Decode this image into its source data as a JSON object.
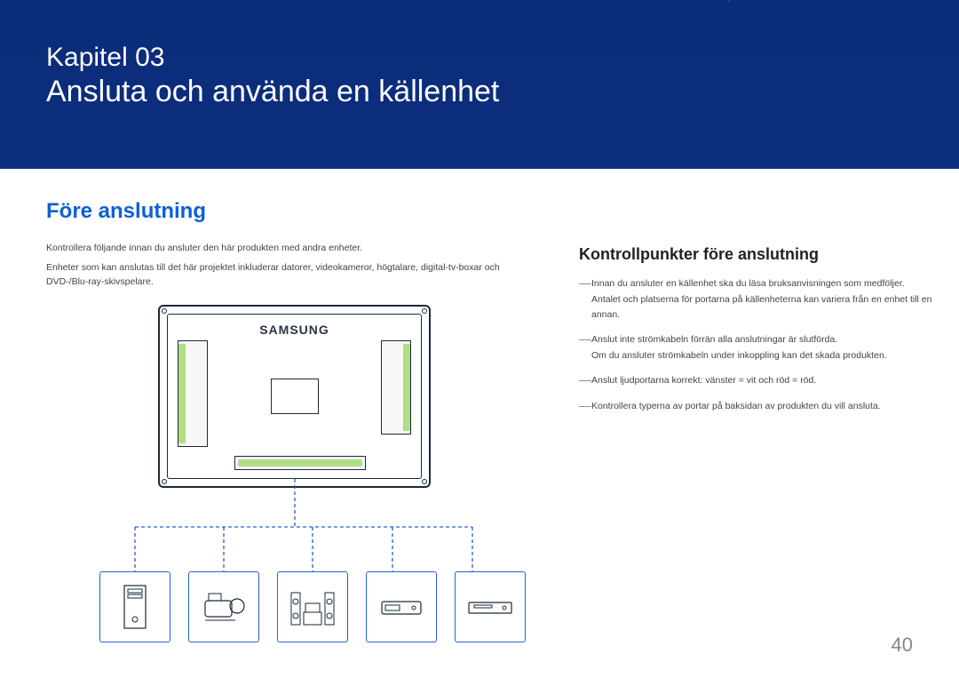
{
  "banner": {
    "chapter_label": "Kapitel 03",
    "chapter_title": "Ansluta och använda en källenhet"
  },
  "section": {
    "heading": "Före anslutning",
    "intro1": "Kontrollera följande innan du ansluter den här produkten med andra enheter.",
    "intro2": "Enheter som kan anslutas till det här projektet inkluderar datorer, videokameror, högtalare, digital-tv-boxar och  DVD-/Blu-ray-skivspelare."
  },
  "checkpoints": {
    "heading": "Kontrollpunkter före anslutning",
    "items": [
      {
        "line": "Innan du ansluter en källenhet ska du läsa bruksanvisningen som medföljer.",
        "sub": "Antalet och platserna för portarna på källenheterna kan variera från en enhet till en annan."
      },
      {
        "line": "Anslut inte strömkabeln förrän alla anslutningar är slutförda.",
        "sub": "Om du ansluter strömkabeln under inkoppling kan det skada produkten."
      },
      {
        "line": "Anslut ljudportarna korrekt: vänster = vit och röd = röd.",
        "sub": ""
      },
      {
        "line": "Kontrollera typerna av portar på baksidan av produkten du vill ansluta.",
        "sub": ""
      }
    ]
  },
  "diagram": {
    "brand_label": "SAMSUNG",
    "devices": [
      "computer-tower",
      "video-camera",
      "speaker-system",
      "set-top-box",
      "dvd-player"
    ]
  },
  "page_number": "40"
}
